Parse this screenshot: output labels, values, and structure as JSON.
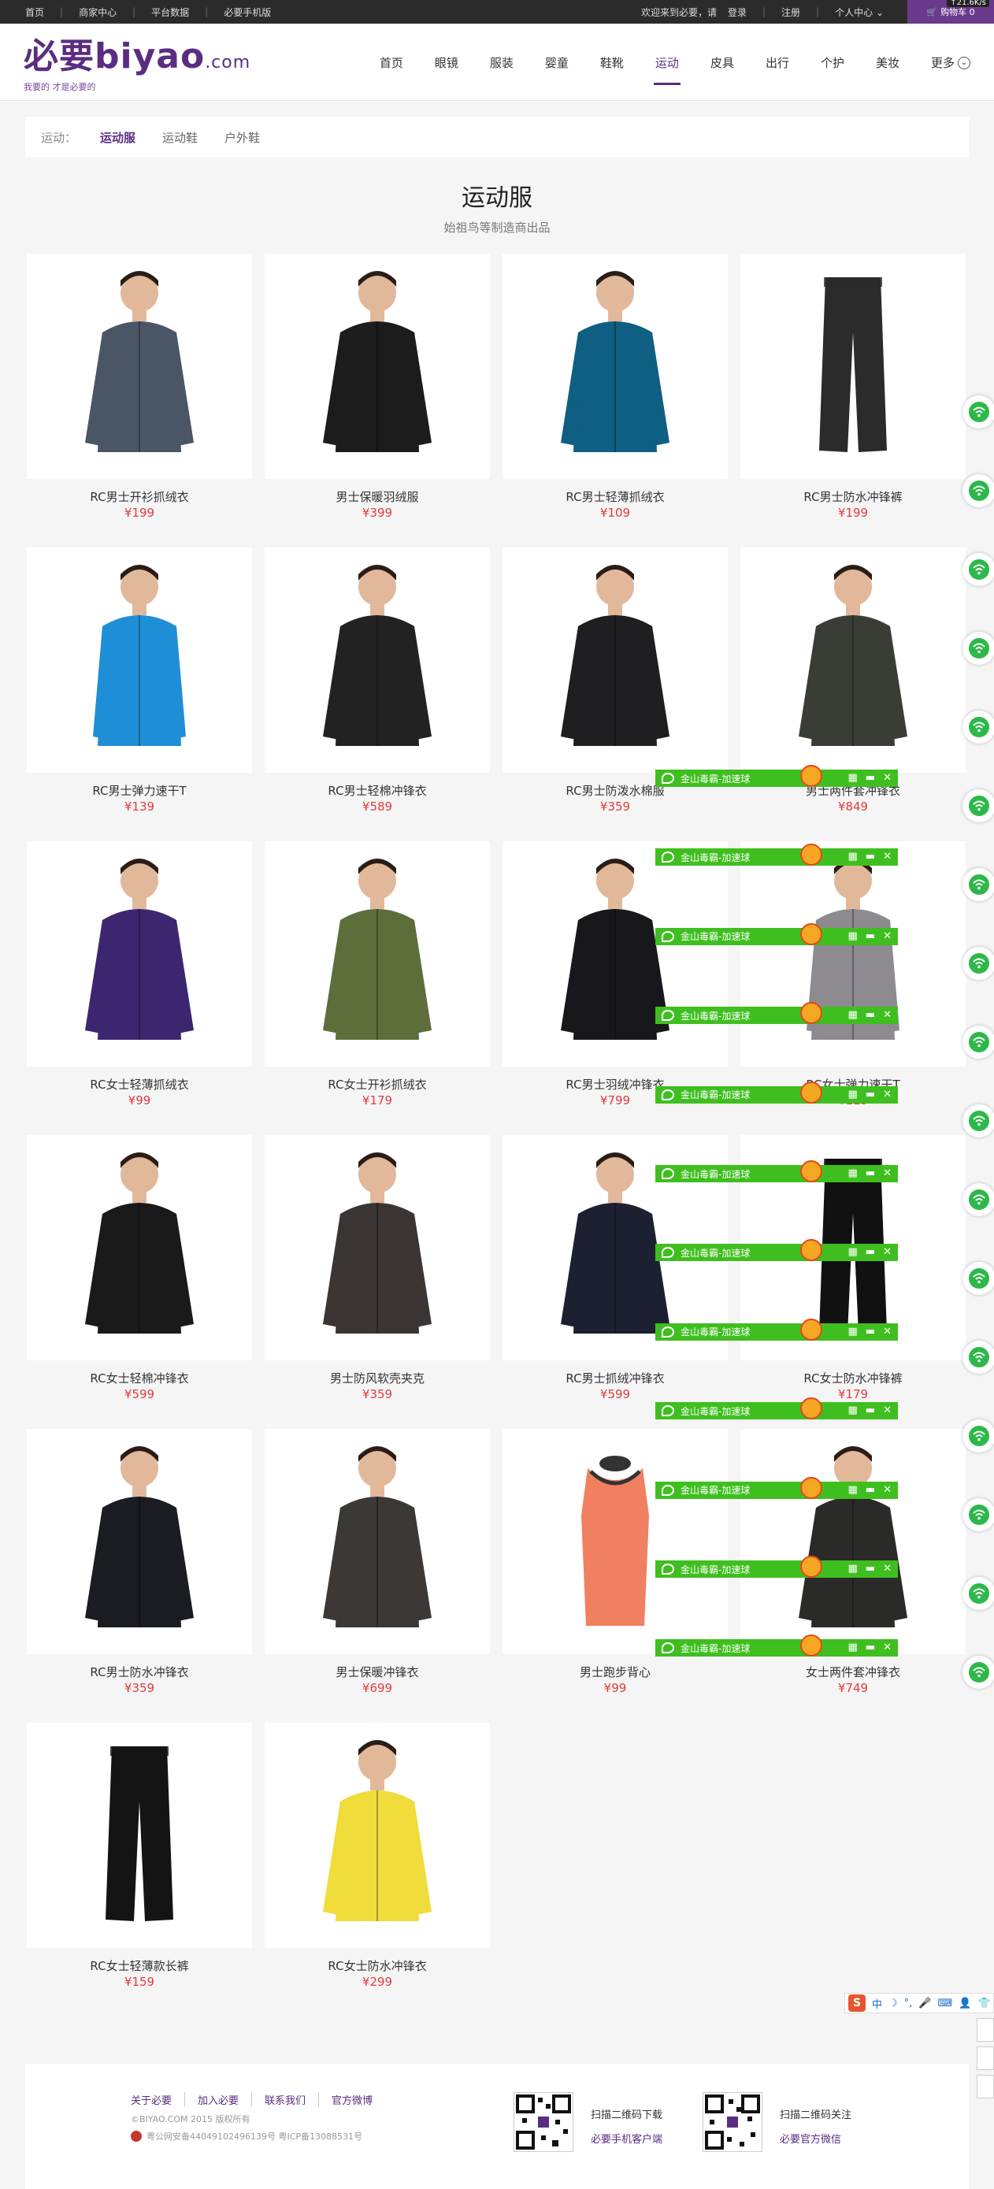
{
  "topbar": {
    "links": [
      "首页",
      "商家中心",
      "平台数据",
      "必要手机版"
    ],
    "welcome": "欢迎来到必要，请",
    "login": "登录",
    "register": "注册",
    "account": "个人中心",
    "account_caret": "⌄",
    "netspeed": "↑21.6K/s",
    "cart_label": "购物车 0"
  },
  "header": {
    "logo_main": "必要biyao",
    "logo_com": ".com",
    "slogan": "我要的 才是必要的",
    "nav": [
      {
        "label": "首页",
        "active": false
      },
      {
        "label": "眼镜",
        "active": false
      },
      {
        "label": "服装",
        "active": false
      },
      {
        "label": "婴童",
        "active": false
      },
      {
        "label": "鞋靴",
        "active": false
      },
      {
        "label": "运动",
        "active": true
      },
      {
        "label": "皮具",
        "active": false
      },
      {
        "label": "出行",
        "active": false
      },
      {
        "label": "个护",
        "active": false
      },
      {
        "label": "美妆",
        "active": false
      }
    ],
    "more_label": "更多",
    "more_icon": "⌄"
  },
  "category": {
    "label": "运动：",
    "items": [
      {
        "label": "运动服",
        "active": true
      },
      {
        "label": "运动鞋",
        "active": false
      },
      {
        "label": "户外鞋",
        "active": false
      }
    ]
  },
  "section": {
    "title": "运动服",
    "subtitle": "始祖鸟等制造商出品"
  },
  "products": [
    {
      "name": "RC男士开衫抓绒衣",
      "price": "¥199",
      "kind": "jacket",
      "color": "#4a5566"
    },
    {
      "name": "男士保暖羽绒服",
      "price": "¥399",
      "kind": "jacket",
      "color": "#1c1c1c"
    },
    {
      "name": "RC男士轻薄抓绒衣",
      "price": "¥109",
      "kind": "jacket",
      "color": "#0f5f82"
    },
    {
      "name": "RC男士防水冲锋裤",
      "price": "¥199",
      "kind": "pants",
      "color": "#2b2b2b"
    },
    {
      "name": "RC男士弹力速干T",
      "price": "¥139",
      "kind": "shirt",
      "color": "#1e8fd6"
    },
    {
      "name": "RC男士轻棉冲锋衣",
      "price": "¥589",
      "kind": "jacket",
      "color": "#222222"
    },
    {
      "name": "RC男士防泼水棉服",
      "price": "¥359",
      "kind": "jacket",
      "color": "#1f1f22"
    },
    {
      "name": "男士两件套冲锋衣",
      "price": "¥849",
      "kind": "jacket",
      "color": "#3a3d36"
    },
    {
      "name": "RC女士轻薄抓绒衣",
      "price": "¥99",
      "kind": "jacket",
      "color": "#3d2670"
    },
    {
      "name": "RC女士开衫抓绒衣",
      "price": "¥179",
      "kind": "jacket",
      "color": "#5d6e3a"
    },
    {
      "name": "RC男士羽绒冲锋衣",
      "price": "¥799",
      "kind": "jacket",
      "color": "#18181c"
    },
    {
      "name": "RC女士弹力速干T",
      "price": "¥119",
      "kind": "shirt",
      "color": "#8d8a90"
    },
    {
      "name": "RC女士轻棉冲锋衣",
      "price": "¥599",
      "kind": "jacket",
      "color": "#1a1a1a"
    },
    {
      "name": "男士防风软壳夹克",
      "price": "¥359",
      "kind": "jacket",
      "color": "#3a3532"
    },
    {
      "name": "RC男士抓绒冲锋衣",
      "price": "¥599",
      "kind": "jacket",
      "color": "#1d2030"
    },
    {
      "name": "RC女士防水冲锋裤",
      "price": "¥179",
      "kind": "pants",
      "color": "#111111"
    },
    {
      "name": "RC男士防水冲锋衣",
      "price": "¥359",
      "kind": "jacket",
      "color": "#1b1b22"
    },
    {
      "name": "男士保暖冲锋衣",
      "price": "¥699",
      "kind": "jacket",
      "color": "#3b3835"
    },
    {
      "name": "男士跑步背心",
      "price": "¥99",
      "kind": "vest",
      "color": "#f08060"
    },
    {
      "name": "女士两件套冲锋衣",
      "price": "¥749",
      "kind": "jacket",
      "color": "#2a2b28"
    },
    {
      "name": "RC女士轻薄款长裤",
      "price": "¥159",
      "kind": "pants",
      "color": "#141414"
    },
    {
      "name": "RC女士防水冲锋衣",
      "price": "¥299",
      "kind": "jacket",
      "color": "#f0dc3a"
    }
  ],
  "overlay": {
    "ks_label": "金山毒霸-加速球",
    "ks_icons": [
      "▦",
      "▬",
      "✕"
    ],
    "ks_count": 12,
    "side_count": 17
  },
  "sogou": {
    "logo": "S",
    "items": [
      "中",
      "☽",
      "°,",
      "🎤",
      "⌨",
      "👤",
      "👕"
    ]
  },
  "footer": {
    "links": [
      "关于必要",
      "加入必要",
      "联系我们",
      "官方微博"
    ],
    "copyright": "©BIYAO.COM 2015 版权所有",
    "icp": "粤公网安备44049102496139号 粤ICP备13088531号",
    "qr1_line1": "扫描二维码下载",
    "qr1_line2": "必要手机客户端",
    "qr2_line1": "扫描二维码关注",
    "qr2_line2": "必要官方微信"
  },
  "colors": {
    "brand": "#5a2d82",
    "price": "#e4393c",
    "ks_green": "#3fbf1f",
    "wifi_green": "#2db84a"
  }
}
